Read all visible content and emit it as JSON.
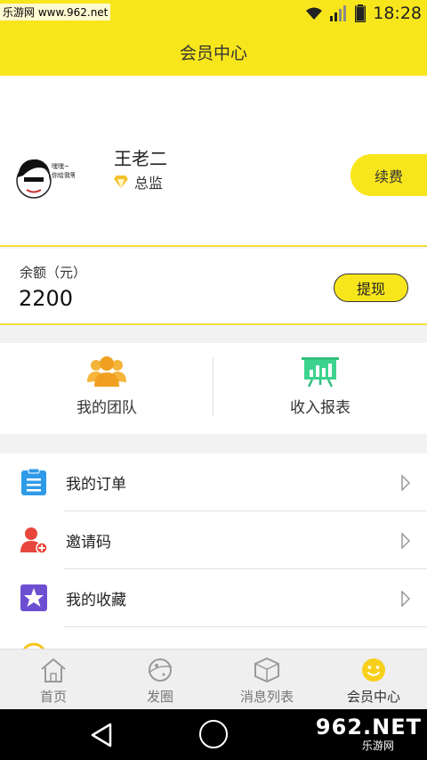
{
  "status_bar": {
    "watermark": "乐游网 www.962.net",
    "time": "18:28"
  },
  "header": {
    "title": "会员中心"
  },
  "profile": {
    "username": "王老二",
    "vip_title": "总监",
    "renew_label": "续费",
    "avatar_caption": "嘿嘿～你给我等"
  },
  "balance": {
    "label": "余额（元）",
    "value": "2200",
    "withdraw_label": "提现"
  },
  "shortcuts": [
    {
      "label": "我的团队",
      "icon": "team-icon"
    },
    {
      "label": "收入报表",
      "icon": "report-chart-icon"
    }
  ],
  "menu": [
    {
      "label": "我的订单",
      "icon": "order-clipboard-icon",
      "color": "#2f9be8"
    },
    {
      "label": "邀请码",
      "icon": "invite-user-icon",
      "color": "#e8453c"
    },
    {
      "label": "我的收藏",
      "icon": "star-icon",
      "color": "#6c4fd1"
    },
    {
      "label": "",
      "icon": "partial-circle-icon",
      "color": "#f8c51c"
    }
  ],
  "tabs": [
    {
      "label": "首页",
      "icon": "home-icon",
      "active": false
    },
    {
      "label": "发圈",
      "icon": "planet-icon",
      "active": false
    },
    {
      "label": "消息列表",
      "icon": "box-icon",
      "active": false
    },
    {
      "label": "会员中心",
      "icon": "smiley-icon",
      "active": true
    }
  ],
  "watermark_bottom": {
    "logo": "962.NET",
    "sub": "乐游网"
  },
  "colors": {
    "brand_yellow": "#f8e61c",
    "accent_border": "#f3dd3a"
  }
}
